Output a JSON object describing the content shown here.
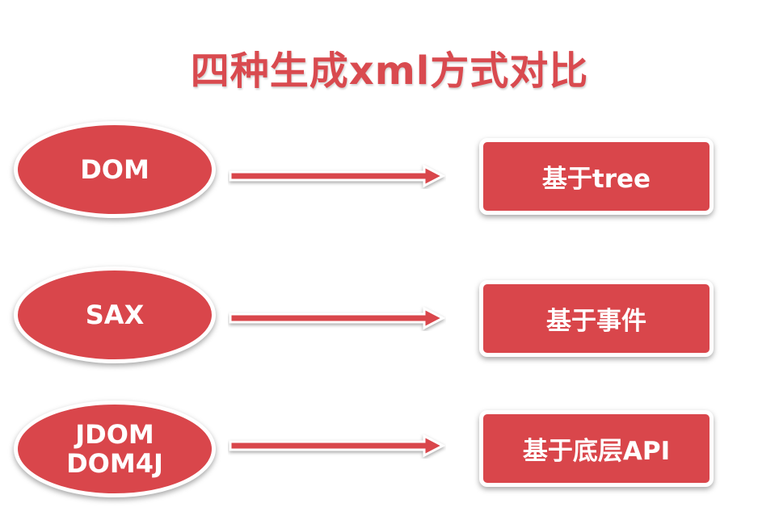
{
  "title": "四种生成xml方式对比",
  "rows": [
    {
      "method_lines": [
        "DOM"
      ],
      "basis": "基于tree"
    },
    {
      "method_lines": [
        "SAX"
      ],
      "basis": "基于事件"
    },
    {
      "method_lines": [
        "JDOM",
        "DOM4J"
      ],
      "basis": "基于底层API"
    }
  ],
  "colors": {
    "accent": "#d9464b",
    "title": "#d94a4f"
  },
  "icons": [
    "right-arrow-icon"
  ]
}
